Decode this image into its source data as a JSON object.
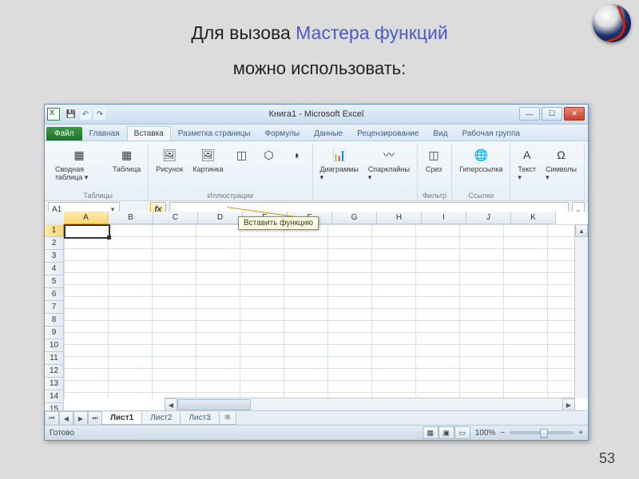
{
  "slide": {
    "title_prefix": "Для вызова ",
    "title_accent": "Мастера функций",
    "subtitle": "можно использовать:",
    "page_number": "53"
  },
  "window": {
    "title": "Книга1 - Microsoft Excel",
    "qat": {
      "save": "💾",
      "undo": "↶",
      "redo": "↷"
    },
    "min": "—",
    "max": "☐",
    "close": "✕"
  },
  "tabs": {
    "file": "Файл",
    "items": [
      "Главная",
      "Вставка",
      "Разметка страницы",
      "Формулы",
      "Данные",
      "Рецензирование",
      "Вид",
      "Рабочая группа"
    ],
    "active_index": 1
  },
  "ribbon": {
    "groups": [
      {
        "label": "Таблицы",
        "items": [
          {
            "icon": "▦",
            "text": "Сводная таблица ▾"
          },
          {
            "icon": "▦",
            "text": "Таблица"
          }
        ]
      },
      {
        "label": "Иллюстрации",
        "items": [
          {
            "icon": "🖼",
            "text": "Рисунок"
          },
          {
            "icon": "🖼",
            "text": "Картинка"
          },
          {
            "icon": "◫",
            "text": ""
          },
          {
            "icon": "⬡",
            "text": ""
          },
          {
            "icon": "◑",
            "text": ""
          }
        ]
      },
      {
        "label": "",
        "items": [
          {
            "icon": "📊",
            "text": "Диаграммы ▾"
          },
          {
            "icon": "〰",
            "text": "Спарклайны ▾"
          }
        ]
      },
      {
        "label": "Фильтр",
        "items": [
          {
            "icon": "◫",
            "text": "Срез"
          }
        ]
      },
      {
        "label": "Ссылки",
        "items": [
          {
            "icon": "🌐",
            "text": "Гиперссылка"
          }
        ]
      },
      {
        "label": "",
        "items": [
          {
            "icon": "A",
            "text": "Текст ▾"
          },
          {
            "icon": "Ω",
            "text": "Символы ▾"
          }
        ]
      }
    ]
  },
  "formula_bar": {
    "name_box": "A1",
    "fx": "fx",
    "tooltip": "Вставить функцию"
  },
  "grid": {
    "columns": [
      "A",
      "B",
      "C",
      "D",
      "E",
      "F",
      "G",
      "H",
      "I",
      "J",
      "K"
    ],
    "row_count": 17,
    "selected_col_index": 0,
    "selected_row_index": 0
  },
  "sheets": {
    "nav": [
      "⏮",
      "◀",
      "▶",
      "⏭"
    ],
    "items": [
      "Лист1",
      "Лист2",
      "Лист3"
    ],
    "active_index": 0,
    "new_glyph": "✻"
  },
  "status": {
    "left": "Готово",
    "views": [
      "▦",
      "▣",
      "▭"
    ],
    "zoom": "100%",
    "minus": "−",
    "plus": "+"
  }
}
